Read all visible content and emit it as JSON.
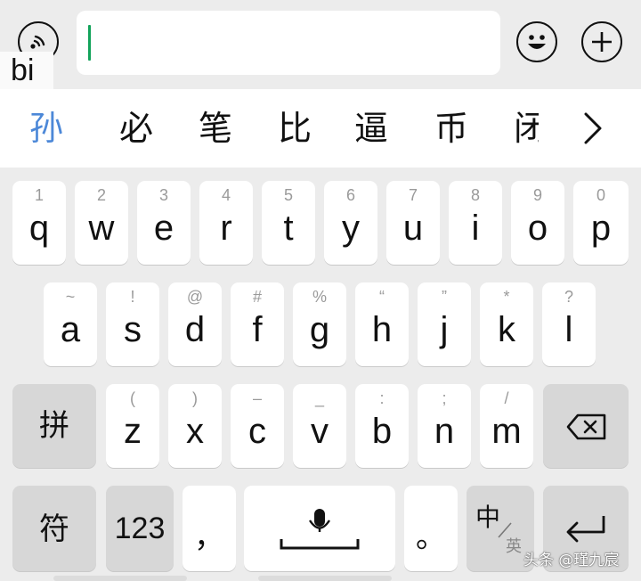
{
  "toolbar": {
    "voice_icon": "voice-wave-icon",
    "input_value": "",
    "emoji_icon": "smiley-icon",
    "plus_icon": "plus-icon"
  },
  "composition": {
    "pinyin": "bi"
  },
  "candidates": {
    "items": [
      "孙",
      "必",
      "笔",
      "比",
      "逼",
      "币",
      "闭"
    ],
    "more": ">"
  },
  "keyboard": {
    "row1": [
      {
        "key": "q",
        "hint": "1"
      },
      {
        "key": "w",
        "hint": "2"
      },
      {
        "key": "e",
        "hint": "3"
      },
      {
        "key": "r",
        "hint": "4"
      },
      {
        "key": "t",
        "hint": "5"
      },
      {
        "key": "y",
        "hint": "6"
      },
      {
        "key": "u",
        "hint": "7"
      },
      {
        "key": "i",
        "hint": "8"
      },
      {
        "key": "o",
        "hint": "9"
      },
      {
        "key": "p",
        "hint": "0"
      }
    ],
    "row2": [
      {
        "key": "a",
        "hint": "~"
      },
      {
        "key": "s",
        "hint": "!"
      },
      {
        "key": "d",
        "hint": "@"
      },
      {
        "key": "f",
        "hint": "#"
      },
      {
        "key": "g",
        "hint": "%"
      },
      {
        "key": "h",
        "hint": "“"
      },
      {
        "key": "j",
        "hint": "”"
      },
      {
        "key": "k",
        "hint": "*"
      },
      {
        "key": "l",
        "hint": "?"
      }
    ],
    "row3": [
      {
        "key": "z",
        "hint": "("
      },
      {
        "key": "x",
        "hint": ")"
      },
      {
        "key": "c",
        "hint": "–"
      },
      {
        "key": "v",
        "hint": "_"
      },
      {
        "key": "b",
        "hint": ":"
      },
      {
        "key": "n",
        "hint": ";"
      },
      {
        "key": "m",
        "hint": "/"
      }
    ],
    "pinyin_mode": "拼",
    "symbols": "符",
    "numbers": "123",
    "comma": "，",
    "period": "。",
    "lang_top": "中",
    "lang_bottom": "英",
    "delete_icon": "backspace-icon",
    "mic_icon": "microphone-icon",
    "space_icon": "space-bar-icon",
    "enter_icon": "return-icon"
  },
  "watermark": "头条 @瑾九宸"
}
